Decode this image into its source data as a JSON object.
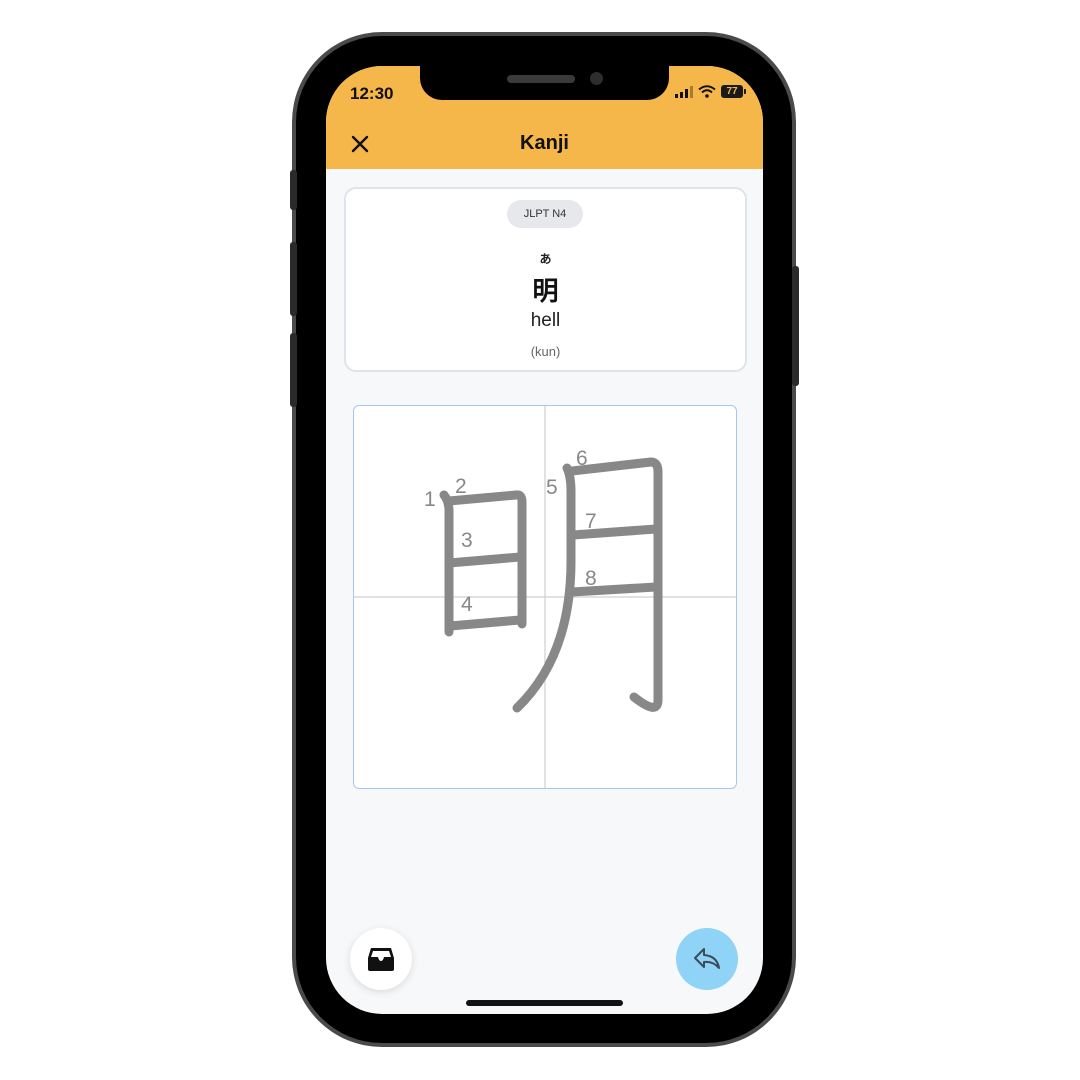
{
  "status_bar": {
    "time": "12:30",
    "battery": "77"
  },
  "header": {
    "title": "Kanji",
    "close_icon": "close-icon"
  },
  "card": {
    "level_badge": "JLPT N4",
    "reading": "あ",
    "kanji": "明",
    "meaning": "hell",
    "reading_type": "(kun)"
  },
  "stroke_canvas": {
    "stroke_numbers": [
      "1",
      "2",
      "3",
      "4",
      "5",
      "6",
      "7",
      "8"
    ]
  },
  "actions": {
    "left_icon": "inbox-tray-icon",
    "right_icon": "undo-arrow-icon"
  },
  "colors": {
    "header": "#f5b64a",
    "fab": "#8fd3f7",
    "stroke": "#888888"
  }
}
